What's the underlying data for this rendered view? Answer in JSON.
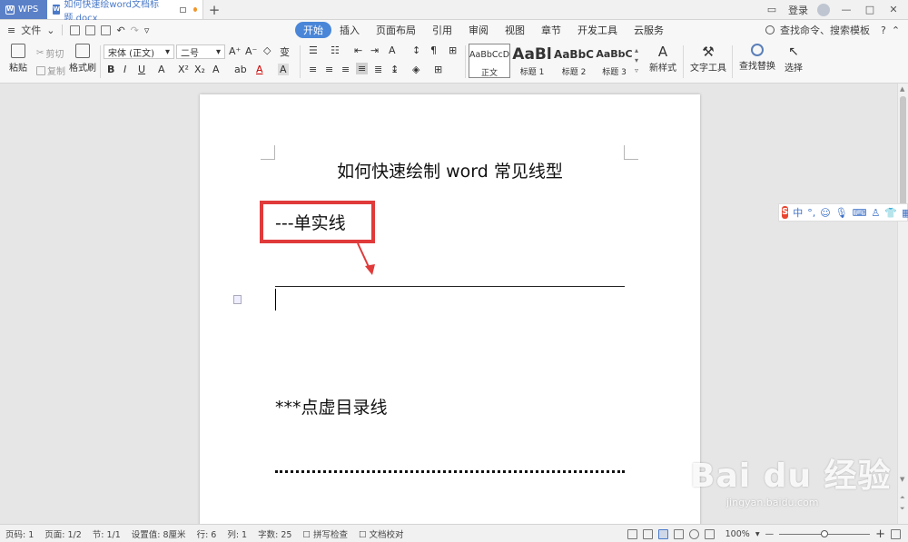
{
  "titlebar": {
    "app_tab": "WPS",
    "doc_tab": "如何快速绘word文档标题.docx",
    "new_tab": "+",
    "login": "登录",
    "win_min": "—",
    "win_max": "□",
    "win_close": "✕"
  },
  "menubar": {
    "file": "文件",
    "tabs": [
      "开始",
      "插入",
      "页面布局",
      "引用",
      "审阅",
      "视图",
      "章节",
      "开发工具",
      "云服务"
    ],
    "active_tab": "开始",
    "search": "查找命令、搜索模板",
    "help": "?"
  },
  "ribbon": {
    "paste": "粘贴",
    "cut": "剪切",
    "copy": "复制",
    "format_painter": "格式刷",
    "font_name": "宋体 (正文)",
    "font_size": "二号",
    "styles": [
      {
        "preview": "AaBbCcD",
        "label": "正文"
      },
      {
        "preview": "AaBl",
        "label": "标题 1"
      },
      {
        "preview": "AaBbC",
        "label": "标题 2"
      },
      {
        "preview": "AaBbC",
        "label": "标题 3"
      }
    ],
    "new_style": "新样式",
    "text_tools": "文字工具",
    "find_replace": "查找替换",
    "select": "选择"
  },
  "document": {
    "title": "如何快速绘制 word 常见线型",
    "heading_solid": "---单实线",
    "heading_dotted": "***点虚目录线"
  },
  "ime": {
    "logo": "S",
    "mode": "中",
    "punct": "°,"
  },
  "watermark": {
    "main": "Bai du 经验",
    "sub": "jingyan.baidu.com"
  },
  "statusbar": {
    "page_no": "页码: 1",
    "pages": "页面: 1/2",
    "section": "节: 1/1",
    "set_value": "设置值: 8厘米",
    "row": "行: 6",
    "col": "列: 1",
    "word_count": "字数: 25",
    "spell_check": "拼写检查",
    "doc_proof": "文档校对",
    "zoom": "100%",
    "zoom_minus": "—",
    "zoom_plus": "+",
    "zoom_fraction": 0.5
  },
  "colors": {
    "accent": "#4a86d8",
    "highlight_box": "#e03a3a"
  }
}
